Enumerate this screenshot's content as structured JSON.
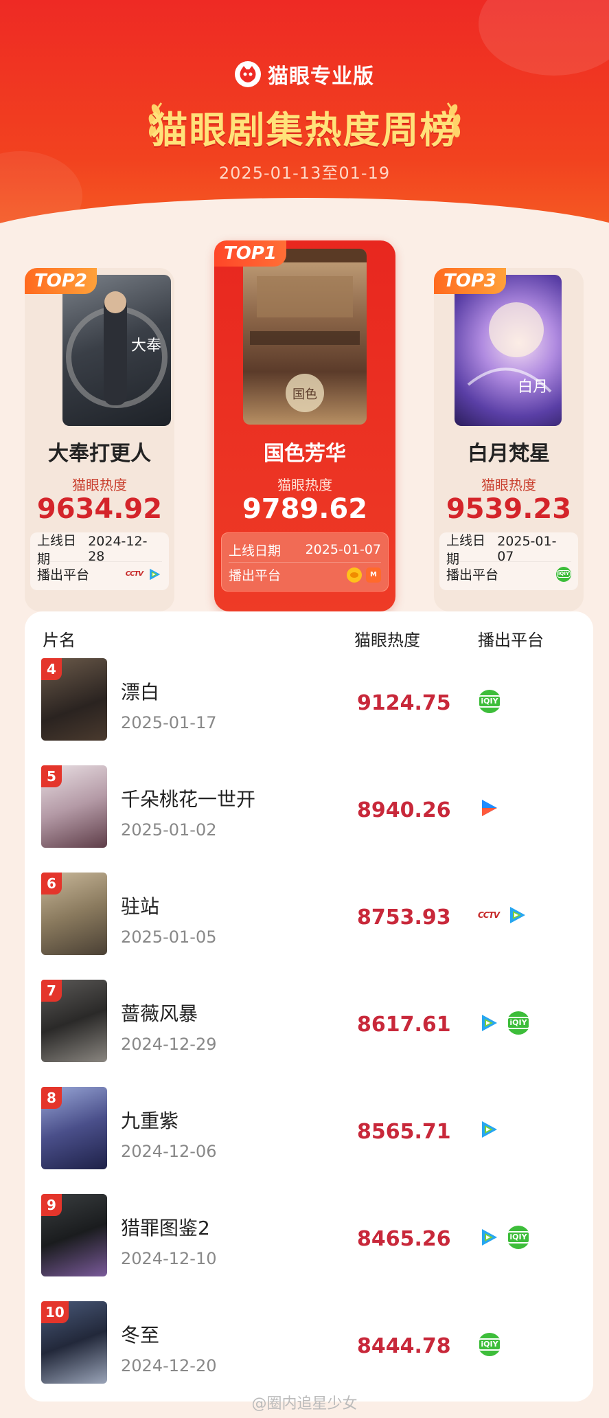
{
  "header": {
    "brand": "猫眼专业版",
    "title": "猫眼剧集热度周榜",
    "date_range": "2025-01-13至01-19"
  },
  "top3": {
    "heat_label": "猫眼热度",
    "release_label": "上线日期",
    "platform_label": "播出平台",
    "first": {
      "rank": "TOP1",
      "title": "国色芳华",
      "heat": "9789.62",
      "release": "2025-01-07",
      "platforms": [
        "mango",
        "mgtv"
      ]
    },
    "second": {
      "rank": "TOP2",
      "title": "大奉打更人",
      "heat": "9634.92",
      "release": "2024-12-28",
      "platforms": [
        "cctv",
        "tencent"
      ]
    },
    "third": {
      "rank": "TOP3",
      "title": "白月梵星",
      "heat": "9539.23",
      "release": "2025-01-07",
      "platforms": [
        "iqiyi"
      ]
    }
  },
  "list": {
    "headers": {
      "name": "片名",
      "heat": "猫眼热度",
      "platform": "播出平台"
    },
    "rows": [
      {
        "rank": "4",
        "title": "漂白",
        "date": "2025-01-17",
        "heat": "9124.75",
        "platforms": [
          "iqiyi"
        ]
      },
      {
        "rank": "5",
        "title": "千朵桃花一世开",
        "date": "2025-01-02",
        "heat": "8940.26",
        "platforms": [
          "youku"
        ]
      },
      {
        "rank": "6",
        "title": "驻站",
        "date": "2025-01-05",
        "heat": "8753.93",
        "platforms": [
          "cctv",
          "tencent"
        ]
      },
      {
        "rank": "7",
        "title": "蔷薇风暴",
        "date": "2024-12-29",
        "heat": "8617.61",
        "platforms": [
          "tencent",
          "iqiyi"
        ]
      },
      {
        "rank": "8",
        "title": "九重紫",
        "date": "2024-12-06",
        "heat": "8565.71",
        "platforms": [
          "tencent"
        ]
      },
      {
        "rank": "9",
        "title": "猎罪图鉴2",
        "date": "2024-12-10",
        "heat": "8465.26",
        "platforms": [
          "tencent",
          "iqiyi"
        ]
      },
      {
        "rank": "10",
        "title": "冬至",
        "date": "2024-12-20",
        "heat": "8444.78",
        "platforms": [
          "iqiyi"
        ]
      }
    ]
  },
  "watermark": "@圈内追星少女",
  "colors": {
    "primary_red": "#ee2a24",
    "heat_red": "#c8283a",
    "gold_title": "#ffe27a",
    "iqiyi_green": "#3dbd3a"
  }
}
